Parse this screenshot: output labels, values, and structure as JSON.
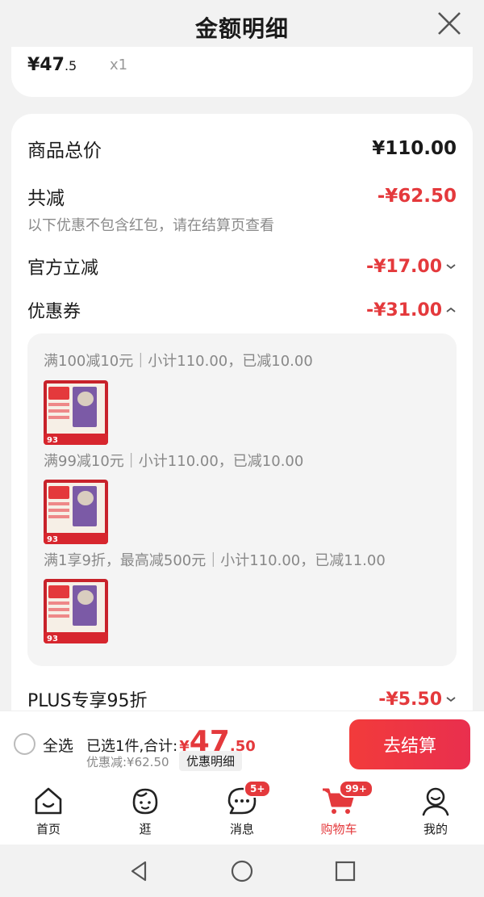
{
  "header": {
    "title": "金额明细"
  },
  "top_item": {
    "price_int": "¥47",
    "price_dec": ".5",
    "qty": "x1"
  },
  "details": {
    "total_label": "商品总价",
    "total_value": "¥110.00",
    "reduce_label": "共减",
    "reduce_value": "-¥62.50",
    "note": "以下优惠不包含红包，请在结算页查看",
    "official_label": "官方立减",
    "official_value": "-¥17.00",
    "coupon_label": "优惠券",
    "coupon_value": "-¥31.00",
    "coupons": [
      {
        "text": "满100减10元｜小计110.00，已减10.00",
        "thumb_num": "93"
      },
      {
        "text": "满99减10元｜小计110.00，已减10.00",
        "thumb_num": "93"
      },
      {
        "text": "满1享9折，最高减500元｜小计110.00，已减11.00",
        "thumb_num": "93"
      }
    ],
    "plus_label": "PLUS专享95折",
    "plus_value": "-¥5.50"
  },
  "checkout": {
    "select_all": "全选",
    "summary_prefix": "已选1件,合计:",
    "sum_yen": "¥",
    "sum_int": "47",
    "sum_dec": ".50",
    "discount": "优惠减:¥62.50",
    "detail_chip": "优惠明细",
    "button": "去结算"
  },
  "tabs": [
    {
      "label": "首页",
      "icon": "home-icon"
    },
    {
      "label": "逛",
      "icon": "face-icon"
    },
    {
      "label": "消息",
      "icon": "message-icon",
      "badge": "5+"
    },
    {
      "label": "购物车",
      "icon": "cart-icon",
      "badge": "99+",
      "active": true
    },
    {
      "label": "我的",
      "icon": "profile-icon"
    }
  ],
  "colors": {
    "accent": "#e4393c",
    "background": "#f2f2f2"
  }
}
